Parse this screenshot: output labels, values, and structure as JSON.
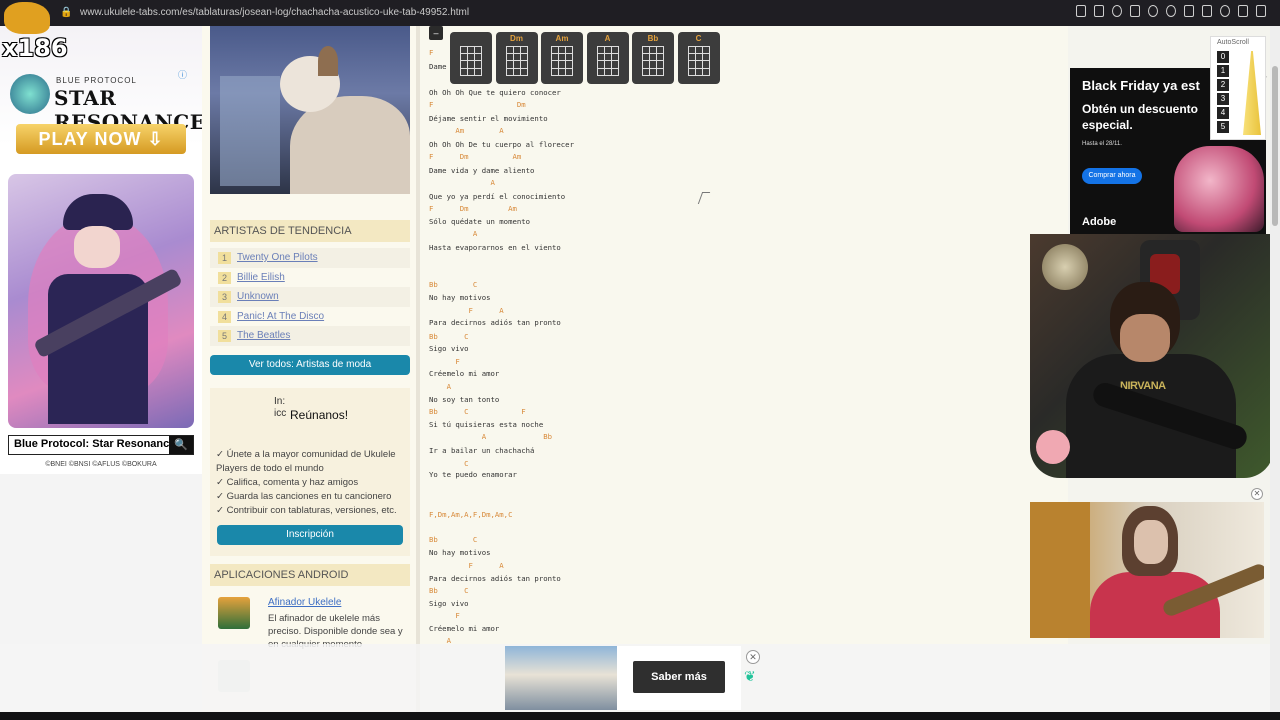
{
  "browser": {
    "url": "www.ukulele-tabs.com/es/tablaturas/josean-log/chachacha-acustico-uke-tab-49952.html"
  },
  "stream_badge": "x186",
  "left_ad": {
    "brand_small": "BLUE PROTOCOL",
    "brand_big": "STAR RESONANCE",
    "cta": "PLAY NOW ⇩",
    "search_text": "Blue Protocol: Star Resonance",
    "copyright": "©BNEI ©BNSI ©AFLUS ©BOKURA"
  },
  "sidebar": {
    "trending_header": "ARTISTAS DE TENDENCIA",
    "artists": [
      {
        "num": "1",
        "name": "Twenty One Pilots"
      },
      {
        "num": "2",
        "name": "Billie Eilish"
      },
      {
        "num": "3",
        "name": "Unknown"
      },
      {
        "num": "4",
        "name": "Panic! At The Disco"
      },
      {
        "num": "5",
        "name": "The Beatles"
      }
    ],
    "see_all_button": "Ver todos: Artistas de moda",
    "community": {
      "img_alt": "In: icc",
      "title": "Reúnanos!",
      "items": [
        "✓ Únete a la mayor comunidad de Ukulele Players de todo el mundo",
        "✓ Califica, comenta y haz amigos",
        "✓ Guarda las canciones en tu cancionero",
        "✓ Contribuir con tablaturas, versiones, etc."
      ],
      "signup_button": "Inscripción"
    },
    "android_header": "APLICACIONES ANDROID",
    "app": {
      "title": "Afinador Ukelele",
      "desc": "El afinador de ukelele más preciso. Disponible donde sea y en cualquier momento"
    }
  },
  "chords": [
    "",
    "Dm",
    "Am",
    "A",
    "Bb",
    "C"
  ],
  "tab": {
    "collapse": "–",
    "lines": [
      {
        "type": "chord",
        "text": "F"
      },
      {
        "type": "lyric",
        "text": "Dame"
      },
      {
        "type": "lyric",
        "text": "Oh Oh Oh Que te quiero conocer"
      },
      {
        "type": "chord",
        "text": "F                   Dm"
      },
      {
        "type": "lyric",
        "text": "Déjame sentir el movimiento"
      },
      {
        "type": "chord",
        "text": "      Am        A"
      },
      {
        "type": "lyric",
        "text": "Oh Oh Oh De tu cuerpo al florecer"
      },
      {
        "type": "chord",
        "text": "F      Dm          Am"
      },
      {
        "type": "lyric",
        "text": "Dame vida y dame aliento"
      },
      {
        "type": "chord",
        "text": "              A"
      },
      {
        "type": "lyric",
        "text": "Que yo ya perdí el conocimiento"
      },
      {
        "type": "chord",
        "text": "F      Dm         Am"
      },
      {
        "type": "lyric",
        "text": "Sólo quédate un momento"
      },
      {
        "type": "chord",
        "text": "          A"
      },
      {
        "type": "lyric",
        "text": "Hasta evaporarnos en el viento"
      },
      {
        "type": "chord",
        "text": "Bb        C"
      },
      {
        "type": "lyric",
        "text": "No hay motivos"
      },
      {
        "type": "chord",
        "text": "         F      A"
      },
      {
        "type": "lyric",
        "text": "Para decirnos adiós tan pronto"
      },
      {
        "type": "chord",
        "text": "Bb      C"
      },
      {
        "type": "lyric",
        "text": "Sigo vivo"
      },
      {
        "type": "chord",
        "text": "      F"
      },
      {
        "type": "lyric",
        "text": "Créemelo mi amor"
      },
      {
        "type": "chord",
        "text": "    A"
      },
      {
        "type": "lyric",
        "text": "No soy tan tonto"
      },
      {
        "type": "chord",
        "text": "Bb      C            F"
      },
      {
        "type": "lyric",
        "text": "Si tú quisieras esta noche"
      },
      {
        "type": "chord",
        "text": "            A             Bb"
      },
      {
        "type": "lyric",
        "text": "Ir a bailar un chachachá"
      },
      {
        "type": "chord",
        "text": "        C"
      },
      {
        "type": "lyric",
        "text": "Yo te puedo enamorar"
      },
      {
        "type": "chord",
        "text": "F,Dm,Am,A,F,Dm,Am,C"
      },
      {
        "type": "chord",
        "text": "Bb        C"
      },
      {
        "type": "lyric",
        "text": "No hay motivos"
      },
      {
        "type": "chord",
        "text": "         F      A"
      },
      {
        "type": "lyric",
        "text": "Para decirnos adiós tan pronto"
      },
      {
        "type": "chord",
        "text": "Bb      C"
      },
      {
        "type": "lyric",
        "text": "Sigo vivo"
      },
      {
        "type": "chord",
        "text": "      F"
      },
      {
        "type": "lyric",
        "text": "Créemelo mi amor"
      },
      {
        "type": "chord",
        "text": "    A"
      }
    ]
  },
  "autoscroll": {
    "label": "AutoScroll",
    "levels": [
      "0",
      "1",
      "2",
      "3",
      "4",
      "5"
    ]
  },
  "right_ad": {
    "title": "Black Friday ya est",
    "subtitle": "Obtén un descuento especial.",
    "date": "Hasta el 28/11.",
    "button": "Comprar ahora",
    "brand": "Adobe"
  },
  "cam1_logo": "NIRVANA",
  "bottom_ad": {
    "button": "Saber más",
    "close": "✕"
  }
}
